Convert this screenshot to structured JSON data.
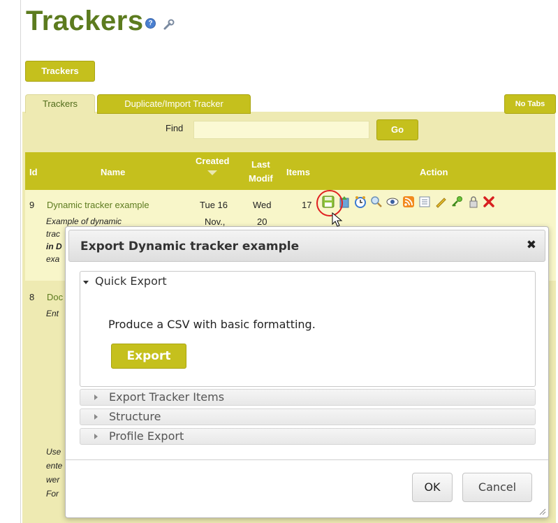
{
  "page": {
    "title": "Trackers",
    "trackers_button": "Trackers",
    "no_tabs_button": "No Tabs",
    "tabs": [
      {
        "label": "Trackers",
        "active": true
      },
      {
        "label": "Duplicate/Import Tracker",
        "active": false
      }
    ],
    "find_label": "Find",
    "find_value": "",
    "go_button": "Go"
  },
  "table": {
    "headers": {
      "id": "Id",
      "name": "Name",
      "created": "Created",
      "last_modif_1": "Last",
      "last_modif_2": "Modif",
      "items": "Items",
      "action": "Action"
    },
    "rows": [
      {
        "id": "9",
        "name": "Dynamic tracker example",
        "created_1": "Tue 16",
        "created_2": "Nov.,",
        "modif_1": "Wed",
        "modif_2": "20",
        "items": "17",
        "desc_lines": [
          "Example of dynamic",
          "trac",
          "in D",
          "exa"
        ]
      },
      {
        "id": "8",
        "name": "Doc",
        "desc_lines": [
          "Ent"
        ],
        "desc_lines_bottom": [
          "Use",
          "ente",
          "wer",
          "For"
        ]
      }
    ],
    "action_icons": [
      "save-export-icon",
      "import-icon",
      "clock-icon",
      "search-icon",
      "eye-icon",
      "rss-icon",
      "list-icon",
      "pencil-icon",
      "key-icon",
      "lock-icon",
      "delete-icon"
    ]
  },
  "dialog": {
    "title": "Export Dynamic tracker example",
    "close_glyph": "✖",
    "quick_export": {
      "label": "Quick Export",
      "description": "Produce a CSV with basic formatting.",
      "export_button": "Export"
    },
    "sections": [
      "Export Tracker Items",
      "Structure",
      "Profile Export"
    ],
    "ok_button": "OK",
    "cancel_button": "Cancel"
  },
  "colors": {
    "brand_green": "#5c7b1e",
    "olive": "#c5c01d",
    "panel": "#eeeab2",
    "highlight": "#e02020"
  }
}
